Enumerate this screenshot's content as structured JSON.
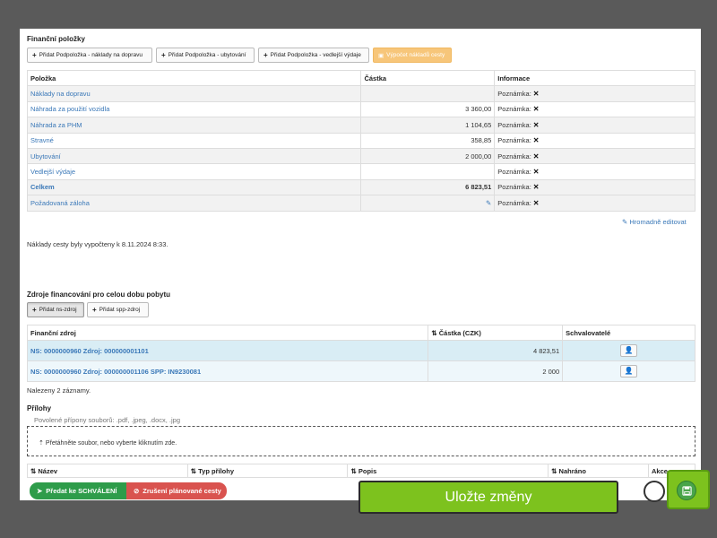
{
  "costs": {
    "title": "Finanční položky",
    "buttons": {
      "add_transport": "Přidat Podpoložka - náklady na dopravu",
      "add_accommodation": "Přidat Podpoložka - ubytování",
      "add_side": "Přidat Podpoložka - vedlejší výdaje",
      "compute": "Výpočet nákladů cesty"
    },
    "columns": [
      "Položka",
      "Částka",
      "Informace"
    ],
    "note_label": "Poznámka:",
    "rows": [
      {
        "name": "Náklady na dopravu",
        "amount": ""
      },
      {
        "name": "Náhrada za použití vozidla",
        "amount": "3 360,00"
      },
      {
        "name": "Náhrada za PHM",
        "amount": "1 104,65"
      },
      {
        "name": "Stravné",
        "amount": "358,85"
      },
      {
        "name": "Ubytování",
        "amount": "2 000,00"
      },
      {
        "name": "Vedlejší výdaje",
        "amount": ""
      },
      {
        "name": "Celkem",
        "amount": "6 823,51"
      },
      {
        "name": "Požadovaná záloha",
        "amount": ""
      }
    ],
    "bulk_edit": "Hromadně editovat",
    "computed_info": "Náklady cesty byly vypočteny k 8.11.2024 8:33."
  },
  "funding": {
    "title": "Zdroje financování pro celou dobu pobytu",
    "add_ns": "Přidat ns-zdroj",
    "add_spp": "Přidat spp-zdroj",
    "columns": [
      "Finanční zdroj",
      "Částka (CZK)",
      "Schvalovatelé"
    ],
    "rows": [
      {
        "source": "NS: 0000000960  Zdroj: 000000001101",
        "amount": "4 823,51"
      },
      {
        "source": "NS: 0000000960  Zdroj: 000000001106  SPP: IN9230081",
        "amount": "2 000"
      }
    ],
    "found": "Nalezeny 2 záznamy."
  },
  "attachments": {
    "title": "Přílohy",
    "allowed": "Povolené přípony souborů: .pdf, .jpeg, .docx, .jpg",
    "dropzone": "Přetáhněte soubor, nebo vyberte kliknutím zde.",
    "columns": [
      "Název",
      "Typ přílohy",
      "Popis",
      "Nahráno",
      "Akce"
    ]
  },
  "footer": {
    "submit": "Předat ke SCHVÁLENÍ",
    "cancel": "Zrušení plánované cesty"
  },
  "tooltip": "Uložte změny"
}
